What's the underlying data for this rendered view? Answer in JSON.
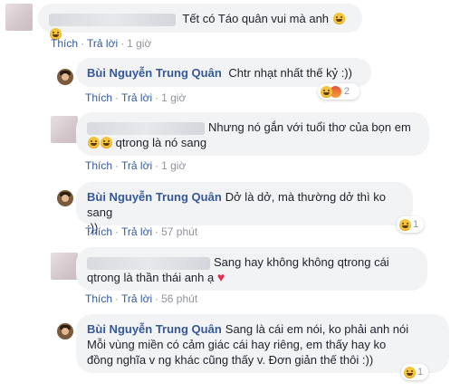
{
  "actions": {
    "like": "Thích",
    "reply": "Trả lời",
    "sep": "·"
  },
  "comments": [
    {
      "author": "",
      "text": "Tết có Táo quân vui mà anh",
      "time": "1 giờ",
      "emojis": 2
    },
    {
      "author": "Bùi Nguyễn Trung Quân",
      "text": "Chtr nhạt nhất thế kỷ :))",
      "time": "1 giờ",
      "reaction_count": "2"
    },
    {
      "author": "",
      "text_line1": "Nhưng nó gắn với tuổi thơ của bọn em",
      "text_line2": "qtrong là nó sang",
      "time": "1 giờ"
    },
    {
      "author": "Bùi Nguyễn Trung Quân",
      "text_line1": "Dở là dở, mà thường dở thì ko sang",
      "text_line2": ":))",
      "time": "57 phút",
      "reaction_count": "1"
    },
    {
      "author": "",
      "text_line1": "Sang hay không không qtrong cái",
      "text_line2": "qtrong là thần thái anh ạ",
      "time": "56 phút"
    },
    {
      "author": "Bùi Nguyễn Trung Quân",
      "text_line1": "Sang là cái em nói, ko phải anh nói",
      "text_line2": "Mỗi vùng miền có cảm giác cái hay riêng, em thấy hay ko",
      "text_line3": "đồng nghĩa v ng khác cũng thấy v. Đơn giản thế thôi :))",
      "time": "",
      "reaction_count": "1"
    }
  ]
}
